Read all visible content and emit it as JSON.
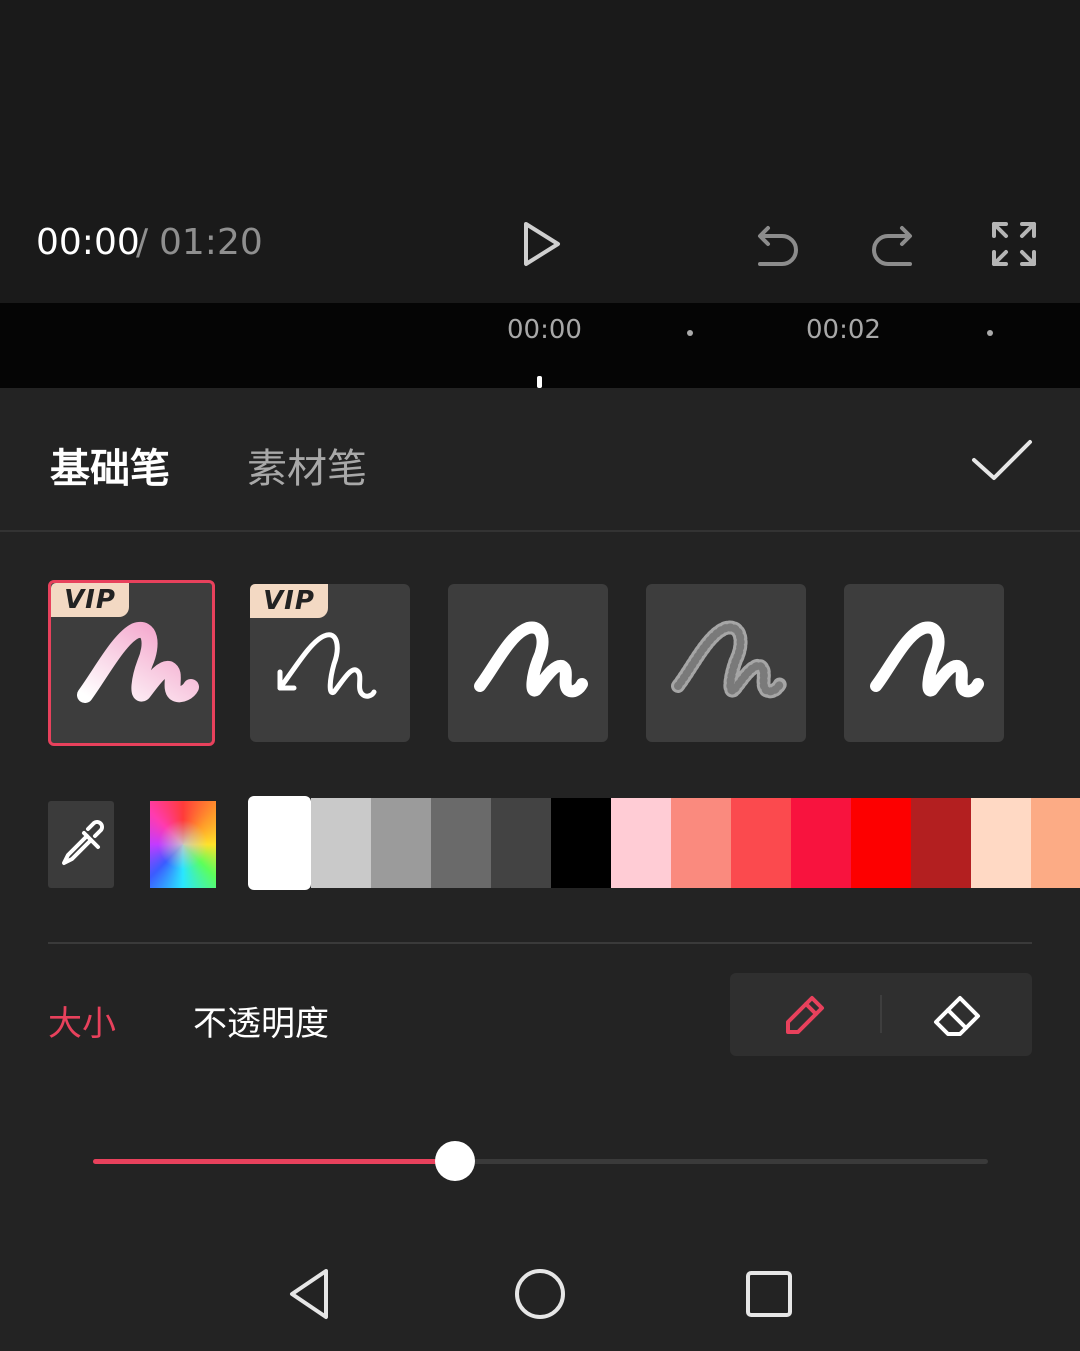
{
  "player": {
    "current_time": "00:00",
    "separator": "/",
    "total_time": "01:20"
  },
  "timeline": {
    "labels": [
      "00:00",
      "00:02"
    ]
  },
  "tabs": {
    "basic": "基础笔",
    "material": "素材笔"
  },
  "brushes": [
    {
      "name": "gradient-pink",
      "vip": true,
      "selected": true
    },
    {
      "name": "arrow",
      "vip": true,
      "selected": false
    },
    {
      "name": "solid",
      "vip": false,
      "selected": false
    },
    {
      "name": "glitter",
      "vip": false,
      "selected": false
    },
    {
      "name": "plain",
      "vip": false,
      "selected": false
    }
  ],
  "vip_badge": "VIP",
  "colors": {
    "accent": "#e8415c",
    "swatches": [
      "#ffffff",
      "#c9c9c9",
      "#9b9b9b",
      "#6a6a6a",
      "#434343",
      "#000000",
      "#ffccd5",
      "#fa8a7e",
      "#fb4a4e",
      "#f8133e",
      "#fd0000",
      "#b31f20",
      "#ffd9c4",
      "#fcab85"
    ]
  },
  "params": {
    "size": "大小",
    "opacity": "不透明度"
  },
  "slider": {
    "value_fraction": 0.405
  },
  "icons": {
    "play": "play-icon",
    "undo": "undo-icon",
    "redo": "redo-icon",
    "fullscreen": "fullscreen-icon",
    "confirm": "check-icon",
    "eyedropper": "eyedropper-icon",
    "pen": "pen-icon",
    "eraser": "eraser-icon",
    "back": "nav-back-icon",
    "home": "nav-home-icon",
    "recents": "nav-recents-icon"
  }
}
